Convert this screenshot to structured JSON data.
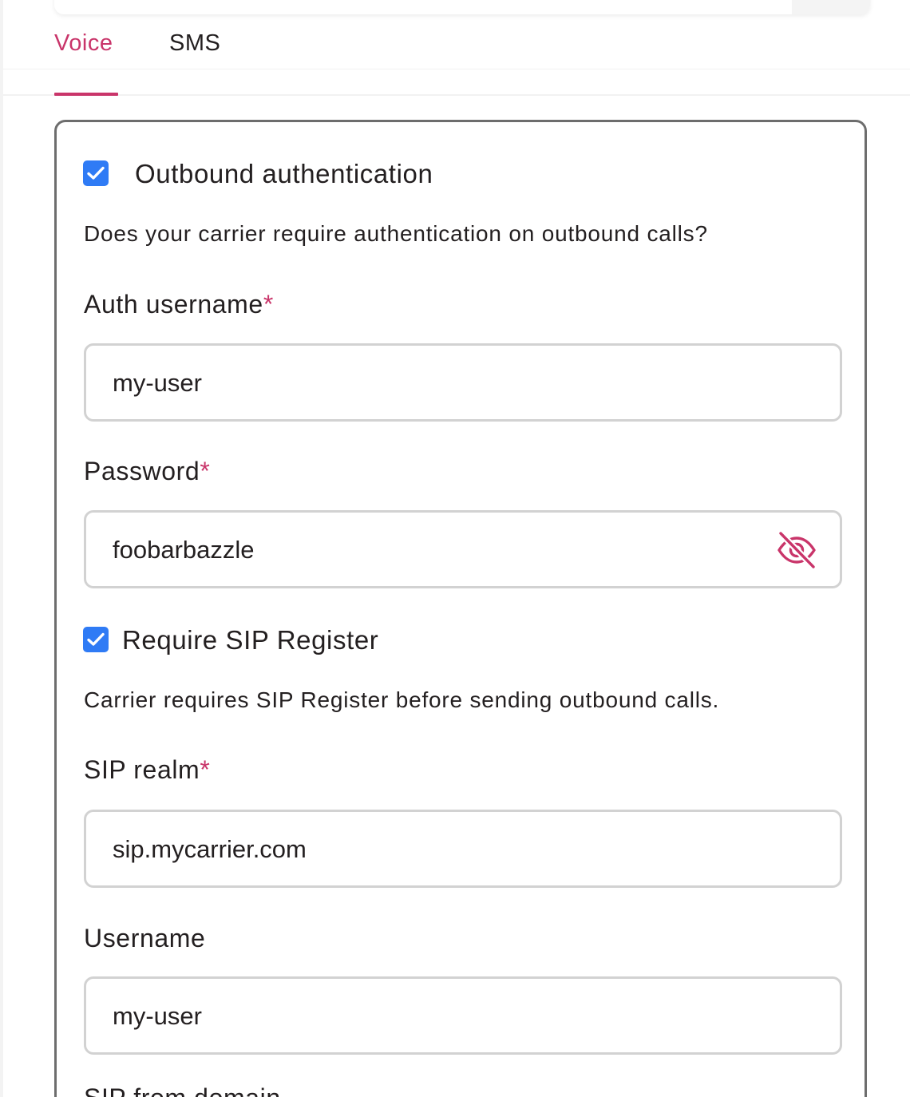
{
  "tabs": [
    {
      "label": "Voice",
      "active": true
    },
    {
      "label": "SMS",
      "active": false
    }
  ],
  "accent_color": "#c9356a",
  "checkbox_color": "#2f7bf5",
  "outbound_auth": {
    "checked": true,
    "title": "Outbound authentication",
    "description": "Does your carrier require authentication on outbound calls?"
  },
  "auth_username": {
    "label": "Auth username",
    "required_mark": "*",
    "value": "my-user"
  },
  "password": {
    "label": "Password",
    "required_mark": "*",
    "value": "foobarbazzle",
    "toggle_icon": "eye-off-icon"
  },
  "sip_register": {
    "checked": true,
    "title": "Require SIP Register",
    "description": "Carrier requires SIP Register before sending outbound calls."
  },
  "sip_realm": {
    "label": "SIP realm",
    "required_mark": "*",
    "value": "sip.mycarrier.com"
  },
  "username": {
    "label": "Username",
    "value": "my-user"
  },
  "next_field_label": "SIP from domain"
}
